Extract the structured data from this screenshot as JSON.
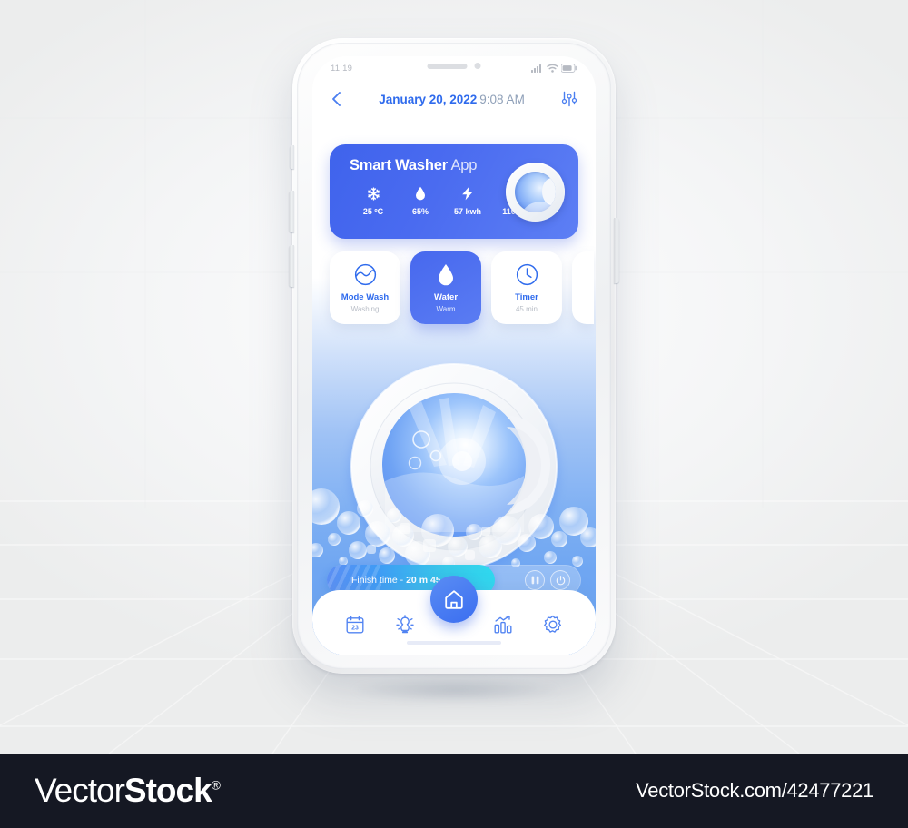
{
  "phone": {
    "status_bar": {
      "time": "11:19",
      "icons": [
        "signal-icon",
        "wifi-icon",
        "battery-icon"
      ]
    },
    "header": {
      "back_icon": "chevron-left-icon",
      "date": "January 20, 2022",
      "time": "9:08 AM",
      "settings_icon": "sliders-icon"
    },
    "banner": {
      "title_bold": "Smart Washer",
      "title_light": "App",
      "device_icon": "washer-drum-icon",
      "stats": [
        {
          "icon": "snowflake-icon",
          "value": "25 ºC"
        },
        {
          "icon": "water-drop-icon",
          "value": "65%"
        },
        {
          "icon": "lightning-bolt-icon",
          "value": "57 kwh"
        },
        {
          "icon": "sun-icon",
          "value": "110 lm"
        }
      ]
    },
    "modes": [
      {
        "icon": "wave-circle-icon",
        "label": "Mode Wash",
        "sub": "Washing",
        "active": false
      },
      {
        "icon": "water-drop-icon",
        "label": "Water",
        "sub": "Warm",
        "active": true
      },
      {
        "icon": "clock-icon",
        "label": "Timer",
        "sub": "45 min",
        "active": false
      }
    ],
    "progress": {
      "label": "Finish time - ",
      "value": "20 m 45 s",
      "percent": 66,
      "pause_icon": "pause-icon",
      "power_icon": "power-icon"
    },
    "nav": [
      {
        "icon": "calendar-icon",
        "badge": "23",
        "active": false
      },
      {
        "icon": "lightbulb-icon",
        "active": false
      },
      {
        "icon": "home-icon",
        "active": true
      },
      {
        "icon": "bar-chart-icon",
        "active": false
      },
      {
        "icon": "gear-icon",
        "active": false
      }
    ]
  },
  "colors": {
    "brand_blue": "#2f6bed",
    "banner_blue": "#4a6bf0",
    "accent_cyan": "#2fd9ef",
    "muted": "#b9bec7",
    "footer_bg": "#151823"
  },
  "footer": {
    "logo_part1": "Vector",
    "logo_part2": "Stock",
    "logo_mark": "®",
    "url": "VectorStock.com/42477221"
  }
}
